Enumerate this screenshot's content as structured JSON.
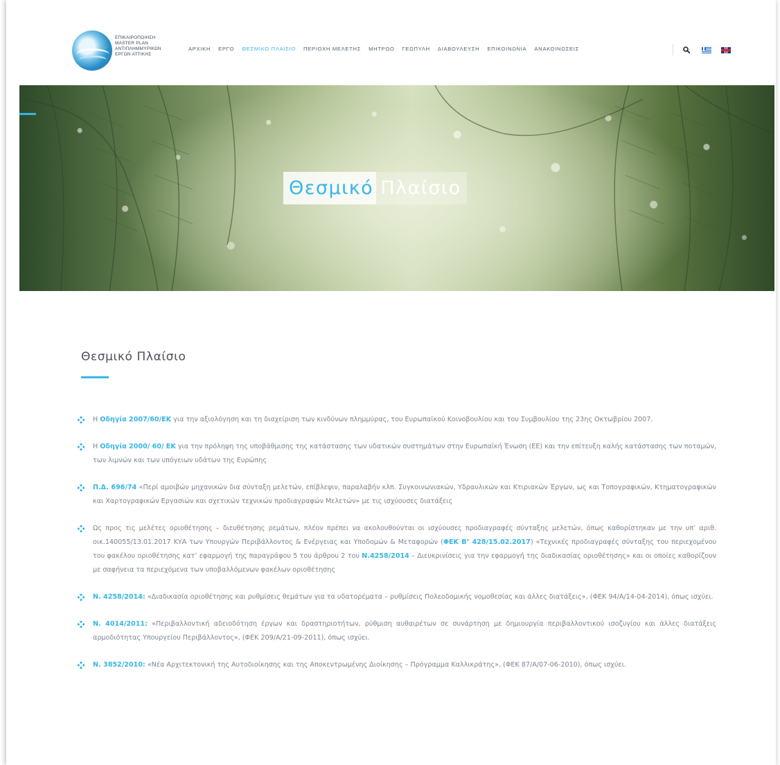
{
  "logo": {
    "lines": [
      "ΕΠΙΚΑΙΡΟΠΟΙΗΣΗ",
      "MASTER PLAN",
      "ΑΝΤΙΠΛΗΜΜΥΡΙΚΩΝ",
      "ΕΡΓΩΝ ΑΤΤΙΚΗΣ"
    ]
  },
  "nav": {
    "items": [
      "ΑΡΧΙΚΗ",
      "ΕΡΓΟ",
      "ΘΕΣΜΙΚΟ ΠΛΑΙΣΙΟ",
      "ΠΕΡΙΟΧΗ ΜΕΛΕΤΗΣ",
      "ΜΗΤΡΩΟ",
      "ΓΕΩΠΥΛΗ",
      "ΔΙΑΒΟΥΛΕΥΣΗ",
      "ΕΠΙΚΟΙΝΩΝΙΑ",
      "ΑΝΑΚΟΙΝΩΣΕΙΣ"
    ],
    "active_index": 2
  },
  "icons": {
    "search": "search-icon",
    "bullet": "diamond-bullet-icon",
    "lang_gr": "greek-flag-icon",
    "lang_en": "uk-flag-icon"
  },
  "hero": {
    "title_part1": "Θεσμικό",
    "title_part2": "Πλαίσιο"
  },
  "section": {
    "title": "Θεσμικό Πλαίσιο"
  },
  "colors": {
    "accent": "#37b6e6",
    "text": "#7d858d",
    "title": "#4a5058"
  },
  "items": [
    {
      "parts": [
        {
          "t": "Η "
        },
        {
          "t": "Οδηγία 2007/60/ΕΚ",
          "link": true
        },
        {
          "t": " για την αξιολόγηση και τη διαχείριση των κινδύνων πλημμύρας, του Ευρωπαϊκού Κοινοβουλίου και του Συμβουλίου της 23ης Οκτωβρίου 2007."
        }
      ]
    },
    {
      "parts": [
        {
          "t": "Η "
        },
        {
          "t": "Οδηγία 2000/ 60/ ΕΚ",
          "link": true
        },
        {
          "t": " για την πρόληψη της υποβάθμισης της κατάστασης των υδατικών συστημάτων στην Ευρωπαϊκή Ένωση (ΕΕ) και την επίτευξη καλής κατάστασης των ποταμών, των λιμνών και των υπόγειων υδάτων της Ευρώπης"
        }
      ]
    },
    {
      "parts": [
        {
          "t": "Π.Δ. 696/74",
          "link": true
        },
        {
          "t": " «Περί αμοιβών μηχανικών δια σύνταξη μελετών, επίβλεψιν, παραλαβήν κλπ. Συγκοινωνιακών, Υδραυλικών και Κτιριακών Έργων, ως και Τοπογραφικών, Κτηματογραφικών και Χαρτογραφικών Εργασιών και σχετικών τεχνικών προδιαγραφών Μελετών» με τις ισχύουσες διατάξεις"
        }
      ]
    },
    {
      "parts": [
        {
          "t": "Ως προς τις μελέτες οριοθέτησης – διευθέτησης ρεμάτων, πλέον πρέπει να ακολουθούνται οι ισχύουσες προδιαγραφές σύνταξης μελετών, όπως καθορίστηκαν με την υπ’ αριθ. οικ.140055/13.01.2017 ΚΥΑ των Υπουργών Περιβάλλοντος & Ενέργειας και Υποδομών & Μεταφορών ("
        },
        {
          "t": "ΦΕΚ Β’ 428/15.02.2017",
          "link": true
        },
        {
          "t": ") «Τεχνικές προδιαγραφές σύνταξης του περιεχομένου του φακέλου οριοθέτησης κατ’ εφαρμογή της παραγράφου 5 του άρθρου 2 του "
        },
        {
          "t": "Ν.4258/2014",
          "link": true
        },
        {
          "t": " – Διευκρινίσεις για την εφαρμογή της διαδικασίας οριοθέτησης» και οι οποίες καθορίζουν με σαφήνεια τα περιεχόμενα των υποβαλλόμενων φακέλων οριοθέτησης"
        }
      ]
    },
    {
      "parts": [
        {
          "t": "Ν. 4258/2014:",
          "link": true
        },
        {
          "t": " «Διαδικασία οριοθέτησης και ρυθμίσεις θεμάτων για τα υδατορέματα – ρυθμίσεις Πολεοδομικής νομοθεσίας και άλλες διατάξεις», (ΦΕΚ 94/Α/14-04-2014), όπως ισχύει."
        }
      ]
    },
    {
      "parts": [
        {
          "t": "Ν. 4014/2011:",
          "link": true
        },
        {
          "t": " «Περιβαλλοντική αδειοδότηση έργων και δραστηριοτήτων, ρύθμιση αυθαιρέτων σε συνάρτηση με δημιουργία περιβαλλοντικού ισοζυγίου και άλλες διατάξεις αρμοδιότητας Υπουργείου Περιβάλλοντος», (ΦΕΚ 209/Α/21-09-2011), όπως ισχύει."
        }
      ]
    },
    {
      "parts": [
        {
          "t": "Ν. 3852/2010:",
          "link": true
        },
        {
          "t": " «Νέα Αρχιτεκτονική της Αυτοδιοίκησης και της Αποκεντρωμένης Διοίκησης – Πρόγραμμα Καλλικράτης», (ΦΕΚ 87/Α/07-06-2010), όπως ισχύει."
        }
      ]
    }
  ]
}
